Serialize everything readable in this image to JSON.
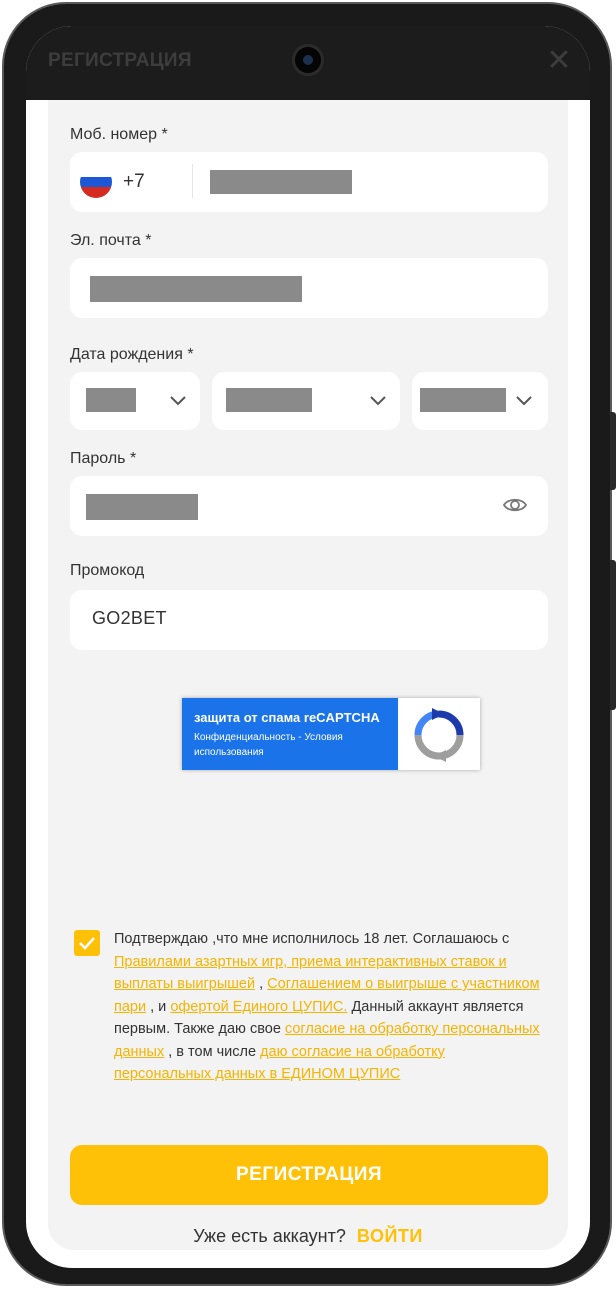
{
  "header": {
    "title": "РЕГИСТРАЦИЯ",
    "close_icon": "close-icon"
  },
  "form": {
    "phone": {
      "label": "Моб. номер *",
      "country_icon": "russia-flag-icon",
      "prefix": "+7",
      "value": ""
    },
    "email": {
      "label": "Эл. почта *",
      "value": ""
    },
    "birthdate": {
      "label": "Дата рождения *",
      "day": "",
      "month": "",
      "year": ""
    },
    "password": {
      "label": "Пароль *",
      "value": "",
      "toggle_icon": "eye-icon"
    },
    "promo": {
      "label": "Промокод",
      "value": "GO2BET"
    }
  },
  "captcha": {
    "title": "защита от спама reCAPTCHA",
    "links": "Конфиденциальность - Условия использования",
    "icon": "recaptcha-logo-icon"
  },
  "consent": {
    "checked": true,
    "t1": "Подтверждаю ,что мне исполнилось 18 лет. Соглашаюсь с ",
    "l1": "Правилами азартных игр, приема интерактивных ставок и выплаты выигрышей",
    "t2": " , ",
    "l2": "Соглашением о выигрыше с участником пари",
    "t3": " , и ",
    "l3": "офертой Единого ЦУПИС.",
    "t4": " Данный аккаунт является первым. Также даю свое ",
    "l4": "согласие на обработку персональных данных",
    "t5": " , в том числе ",
    "l5": "даю согласие на обработку персональных данных в ЕДИНОМ ЦУПИС"
  },
  "actions": {
    "register_label": "РЕГИСТРАЦИЯ",
    "have_account": "Уже есть аккаунт?",
    "login_label": "ВОЙТИ"
  },
  "colors": {
    "accent": "#ffc107",
    "link": "#f5b400",
    "panel": "#f3f3f3",
    "captcha_blue": "#1a73e8"
  }
}
